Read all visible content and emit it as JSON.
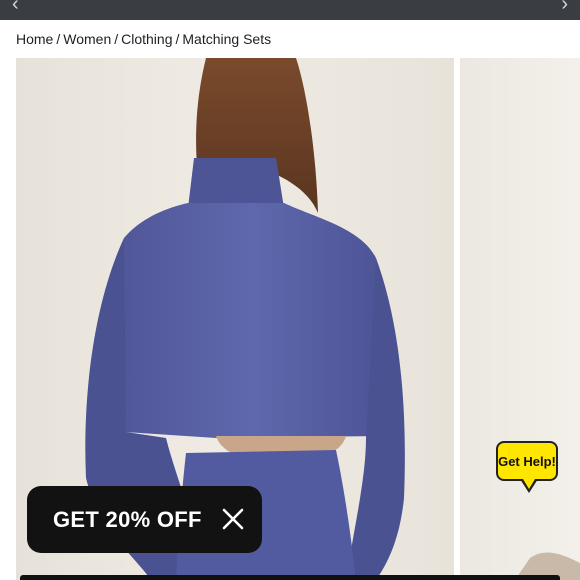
{
  "breadcrumb": {
    "items": [
      "Home",
      "Women",
      "Clothing",
      "Matching Sets"
    ],
    "separator": "/"
  },
  "nav": {
    "prev_icon": "chevron-left-icon",
    "next_icon": "chevron-right-icon"
  },
  "promo": {
    "label": "GET 20% OFF",
    "close_icon": "close-icon"
  },
  "help": {
    "label": "Get Help!",
    "color": "#ffe600"
  },
  "colors": {
    "topbar": "#3a3d42",
    "sweater": "#5b64a6",
    "promo_bg": "#121212"
  }
}
